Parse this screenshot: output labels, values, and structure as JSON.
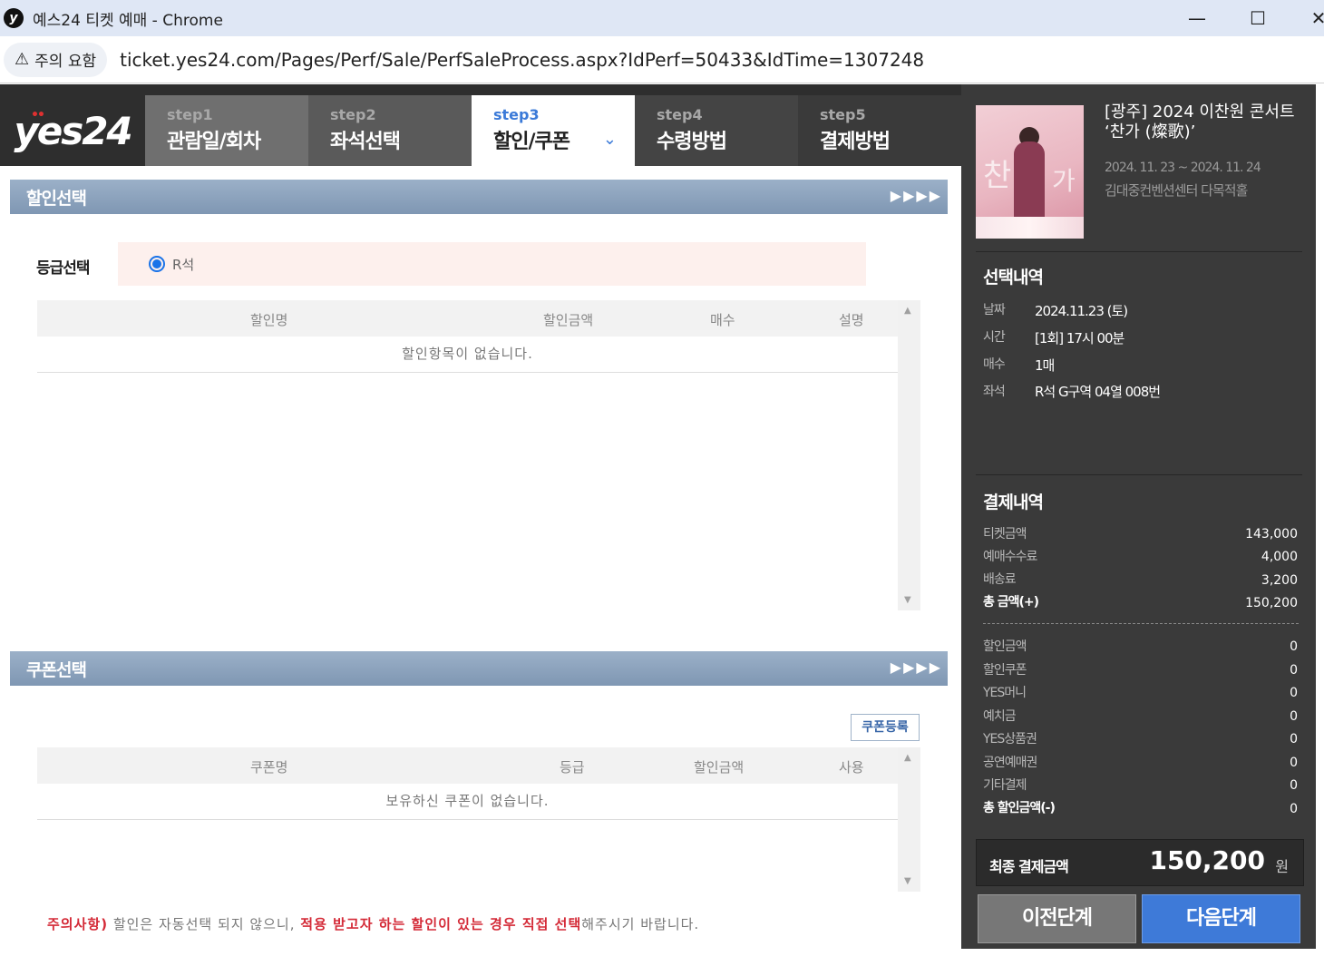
{
  "window": {
    "title": "예스24 티켓 예매 - Chrome",
    "app_icon": "y",
    "minimize": "—",
    "maximize": "☐",
    "close": "✕"
  },
  "address": {
    "security_label": "주의 요함",
    "url": "ticket.yes24.com/Pages/Perf/Sale/PerfSaleProcess.aspx?IdPerf=50433&IdTime=1307248"
  },
  "logo": {
    "text": "yes24"
  },
  "steps": [
    {
      "num": "step1",
      "label": "관람일/회차"
    },
    {
      "num": "step2",
      "label": "좌석선택"
    },
    {
      "num": "step3",
      "label": "할인/쿠폰"
    },
    {
      "num": "step4",
      "label": "수령방법"
    },
    {
      "num": "step5",
      "label": "결제방법"
    }
  ],
  "discount": {
    "section_title": "할인선택",
    "arrows": "▶▶▶▶",
    "grade_label": "등급선택",
    "grade_option": "R석",
    "columns": [
      "할인명",
      "할인금액",
      "매수",
      "설명"
    ],
    "empty_text": "할인항목이 없습니다."
  },
  "coupon": {
    "section_title": "쿠폰선택",
    "arrows": "▶▶▶▶",
    "register_button": "쿠폰등록",
    "columns": [
      "쿠폰명",
      "등급",
      "할인금액",
      "사용"
    ],
    "empty_text": "보유하신 쿠폰이 없습니다."
  },
  "notice": {
    "prefix": "주의사항)",
    "part1": " 할인은 자동선택 되지 않으니, ",
    "highlight": "적용 받고자 하는 할인이 있는 경우 직접 선택",
    "part2": "해주시기 바랍니다."
  },
  "performance": {
    "title": "[광주] 2024 이찬원 콘서트 ‘찬가 (燦歌)’",
    "date_range": "2024. 11. 23 ~ 2024. 11. 24",
    "venue": "김대중컨벤션센터 다목적홀",
    "poster_chars": [
      "찬",
      "가"
    ]
  },
  "selection": {
    "heading": "선택내역",
    "items": [
      {
        "key": "날짜",
        "value": "2024.11.23 (토)"
      },
      {
        "key": "시간",
        "value": "[1회] 17시 00분"
      },
      {
        "key": "매수",
        "value": "1매"
      },
      {
        "key": "좌석",
        "value": "R석 G구역 04열 008번"
      }
    ]
  },
  "payment": {
    "heading": "결제내역",
    "charges": [
      {
        "key": "티켓금액",
        "value": "143,000"
      },
      {
        "key": "예매수수료",
        "value": "4,000"
      },
      {
        "key": "배송료",
        "value": "3,200"
      },
      {
        "key": "총 금액(+)",
        "value": "150,200"
      }
    ],
    "discounts": [
      {
        "key": "할인금액",
        "value": "0"
      },
      {
        "key": "할인쿠폰",
        "value": "0"
      },
      {
        "key": "YES머니",
        "value": "0"
      },
      {
        "key": "예치금",
        "value": "0"
      },
      {
        "key": "YES상품권",
        "value": "0"
      },
      {
        "key": "공연예매권",
        "value": "0"
      },
      {
        "key": "기타결제",
        "value": "0"
      },
      {
        "key": "총 할인금액(-)",
        "value": "0"
      }
    ],
    "final_label": "최종 결제금액",
    "final_value": "150,200",
    "final_unit": "원"
  },
  "buttons": {
    "prev": "이전단계",
    "next": "다음단계"
  },
  "colors": {
    "accent_blue": "#3e7ad8",
    "notice_red": "#d42a37",
    "panel_dark": "#3a3a3a",
    "section_bar": "#8ea4be"
  }
}
